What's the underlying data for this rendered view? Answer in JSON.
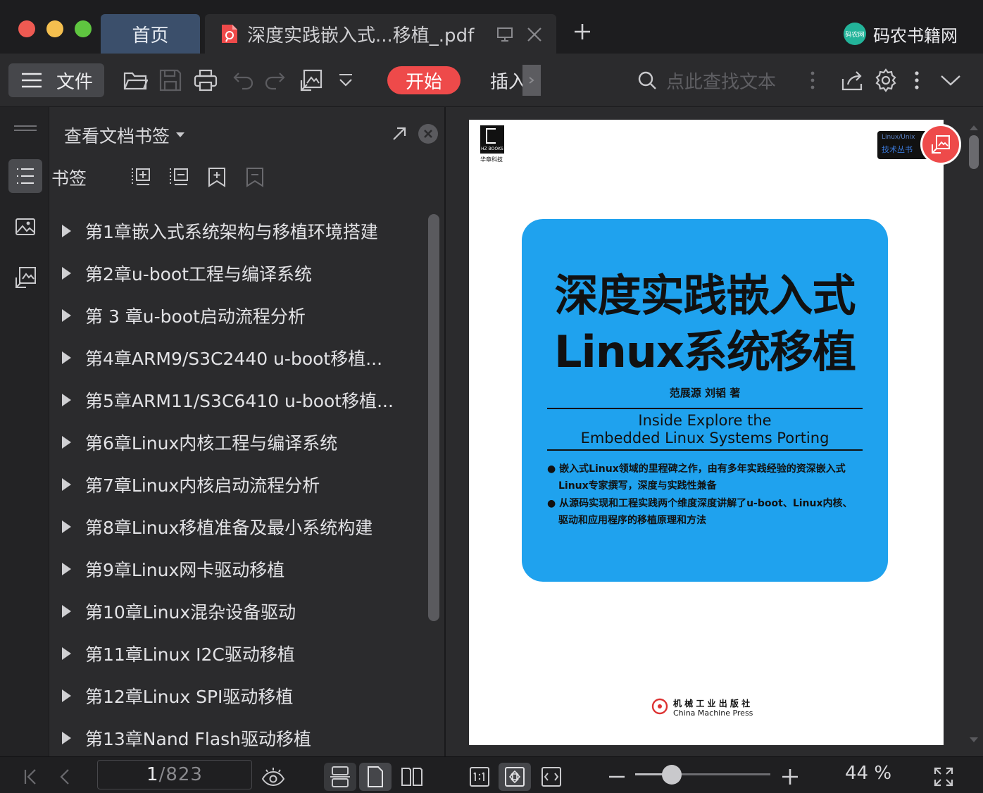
{
  "window": {
    "traffic_lights": {
      "close": "#ee5a52",
      "minimize": "#f4bf4f",
      "zoom": "#5fc640"
    }
  },
  "tabs": [
    {
      "label": "首页",
      "active": false
    },
    {
      "label": "深度实践嵌入式...移植_.pdf",
      "active": true
    }
  ],
  "brand": {
    "name": "码农书籍网",
    "badge": "码农网"
  },
  "toolbar": {
    "file_label": "文件",
    "start_label": "开始",
    "insert_label": "插入",
    "search_placeholder": "点此查找文本",
    "accent": "#ee4a4a"
  },
  "panel": {
    "title": "查看文档书签",
    "bookmarks_label": "书签",
    "bookmarks": [
      "第1章嵌入式系统架构与移植环境搭建",
      "第2章u-boot工程与编译系统",
      "第 3 章u-boot启动流程分析",
      "第4章ARM9/S3C2440 u-boot移植...",
      "第5章ARM11/S3C6410 u-boot移植...",
      "第6章Linux内核工程与编译系统",
      "第7章Linux内核启动流程分析",
      "第8章Linux移植准备及最小系统构建",
      "第9章Linux网卡驱动移植",
      "第10章Linux混杂设备驱动",
      "第11章Linux I2C驱动移植",
      "第12章Linux SPI驱动移植",
      "第13章Nand Flash驱动移植"
    ]
  },
  "document": {
    "publisher_logo": "HZ BOOKS",
    "publisher_cn": "华章科技",
    "series_tag_1": "Linux/Unix",
    "series_tag_2": "技术丛书",
    "title_line1": "深度实践嵌入式",
    "title_line2": "Linux系统移植",
    "authors": "范展源  刘韬     著",
    "en_title_line1": "Inside Explore the",
    "en_title_line2": "Embedded Linux Systems Porting",
    "bullet1_line1": "● 嵌入式Linux领域的里程碑之作，由有多年实践经验的资深嵌入式",
    "bullet1_line2": "Linux专家撰写，深度与实践性兼备",
    "bullet2_line1": "● 从源码实现和工程实践两个维度深度讲解了u-boot、Linux内核、",
    "bullet2_line2": "驱动和应用程序的移植原理和方法",
    "press_cn": "机 械 工 业 出 版 社",
    "press_en": "China Machine Press",
    "cover_color": "#1fa2ee"
  },
  "status": {
    "current_page": "1",
    "page_separator": "/",
    "total_pages": "823",
    "zoom_label": "44 %",
    "zoom_fraction": 0.27
  }
}
